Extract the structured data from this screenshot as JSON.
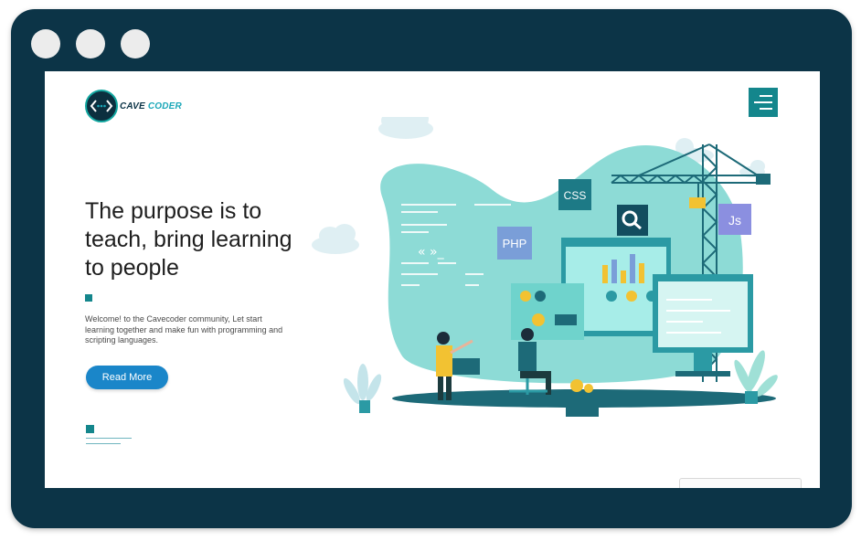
{
  "brand": {
    "name_part1": "CAVE",
    "name_part2": "CODER",
    "accent_color": "#1aa7b8",
    "dark_color": "#0c3447"
  },
  "header": {
    "menu_icon": "hamburger-menu-icon"
  },
  "hero": {
    "headline": "The purpose is to teach, bring learning to people",
    "description": "Welcome! to the Cavecoder community, Let start learning together and make fun with programming and scripting languages.",
    "cta_label": "Read More",
    "cta_color": "#1a86c9"
  },
  "illustration": {
    "tags": {
      "css": "CSS",
      "php": "PHP",
      "js": "Js"
    },
    "primary_color": "#8ddbd6",
    "teal_color": "#14868c"
  }
}
